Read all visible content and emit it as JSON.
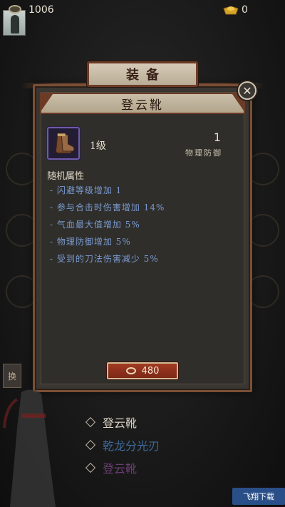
{
  "topbar": {
    "coins": "1006",
    "ingots": "0",
    "coin_icon": "coin-icon",
    "ingot_icon": "gold-ingot-icon"
  },
  "panel": {
    "title": "装备",
    "item_name": "登云靴",
    "close_icon": "close-icon",
    "item_icon": "boots-icon",
    "level": "1级",
    "stat_value": "1",
    "stat_label": "物理防御",
    "attributes_heading": "随机属性",
    "attributes": [
      "- 闪避等级增加 1",
      "- 参与合击时伤害增加 14%",
      "- 气血最大值增加 5%",
      "- 物理防御增加 5%",
      "- 受到的刀法伤害减少 5%"
    ],
    "price": "480",
    "price_icon": "coin-icon"
  },
  "side_chip": "换",
  "menu": {
    "items": [
      {
        "label": "登云靴",
        "color": "#d9d1c2"
      },
      {
        "label": "乾龙分光刃",
        "color": "#3e6a9a"
      },
      {
        "label": "登云靴",
        "color": "#6b3e74"
      }
    ]
  },
  "watermark": "飞翔下载",
  "colors": {
    "panel_border": "#7a4f35",
    "attribute_text": "#7a9bd0",
    "price_button": "#a13a22"
  }
}
